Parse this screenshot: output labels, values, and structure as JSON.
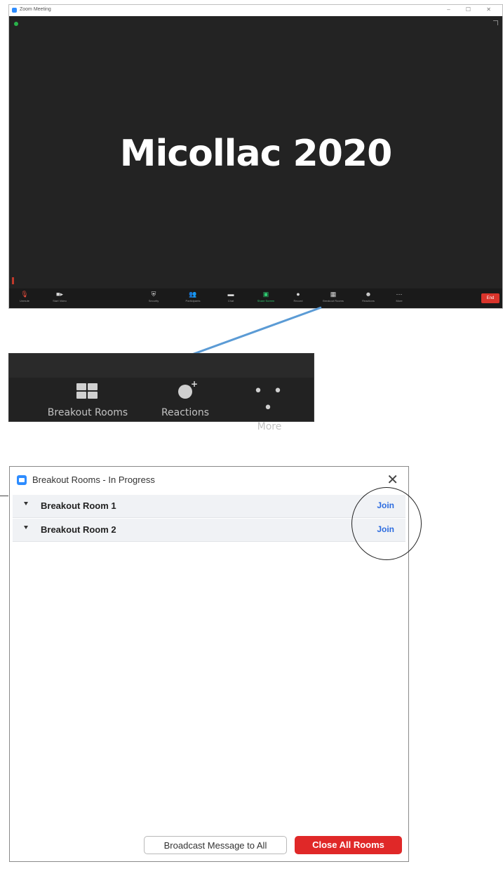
{
  "zoom_window": {
    "title": "Zoom Meeting",
    "window_controls": "– ☐ ✕",
    "meeting_title": "Micollac 2020",
    "toolbar": [
      {
        "name": "unmute",
        "label": "Unmute",
        "icon": "mic-icon"
      },
      {
        "name": "start-video",
        "label": "Start Video",
        "icon": "video-icon"
      },
      {
        "name": "security",
        "label": "Security",
        "icon": "shield-icon"
      },
      {
        "name": "participants",
        "label": "Participants",
        "icon": "people-icon"
      },
      {
        "name": "chat",
        "label": "Chat",
        "icon": "chat-icon"
      },
      {
        "name": "share-screen",
        "label": "Share Screen",
        "icon": "share-icon"
      },
      {
        "name": "record",
        "label": "Record",
        "icon": "record-icon"
      },
      {
        "name": "breakout-rooms",
        "label": "Breakout Rooms",
        "icon": "grid-icon"
      },
      {
        "name": "reactions",
        "label": "Reactions",
        "icon": "smile-icon"
      },
      {
        "name": "more",
        "label": "More",
        "icon": "dots-icon"
      }
    ],
    "end_button": "End"
  },
  "zoomed_toolbar": {
    "breakout_label": "Breakout Rooms",
    "reactions_label": "Reactions",
    "more_label": "More",
    "more_glyph": "• • •"
  },
  "dialog": {
    "title": "Breakout Rooms - In Progress",
    "close_glyph": "✕",
    "rooms": [
      {
        "name": "Breakout Room 1",
        "action": "Join"
      },
      {
        "name": "Breakout Room 2",
        "action": "Join"
      }
    ],
    "broadcast_button": "Broadcast Message to All",
    "close_all_button": "Close All Rooms"
  },
  "colors": {
    "accent": "#2d8cff",
    "danger": "#e02828",
    "link": "#2d6cdf",
    "share_green": "#2ecc71",
    "arrow": "#5b9bd5"
  }
}
